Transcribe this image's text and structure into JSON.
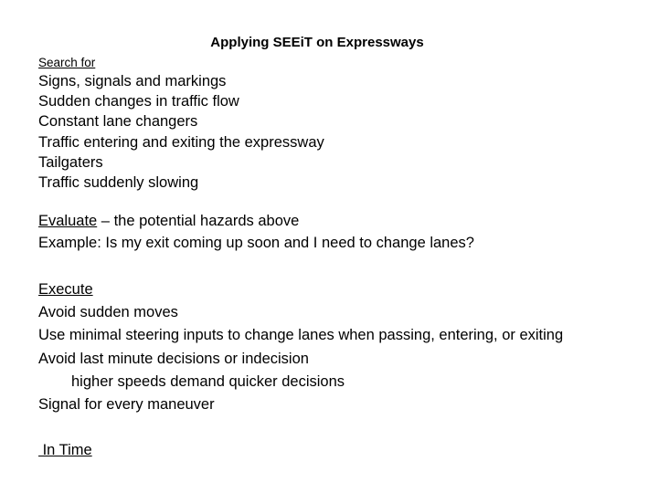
{
  "title": "Applying SEEiT on Expressways",
  "search": {
    "heading": "Search for",
    "items": [
      "Signs, signals and markings",
      "Sudden changes in traffic flow",
      "Constant lane changers",
      "Traffic entering and exiting the expressway",
      "Tailgaters",
      "Traffic suddenly slowing"
    ]
  },
  "evaluate": {
    "heading": "Evaluate",
    "heading_rest": " – the potential hazards above",
    "example": "Example: Is my exit coming up soon and I need to change lanes?"
  },
  "execute": {
    "heading": "Execute",
    "items": [
      "Avoid sudden moves",
      "Use minimal steering inputs to change lanes when passing, entering, or exiting",
      "Avoid last minute decisions or indecision"
    ],
    "sub_item": "higher speeds demand quicker decisions",
    "last_item": "Signal for every maneuver"
  },
  "in_time": " In Time"
}
